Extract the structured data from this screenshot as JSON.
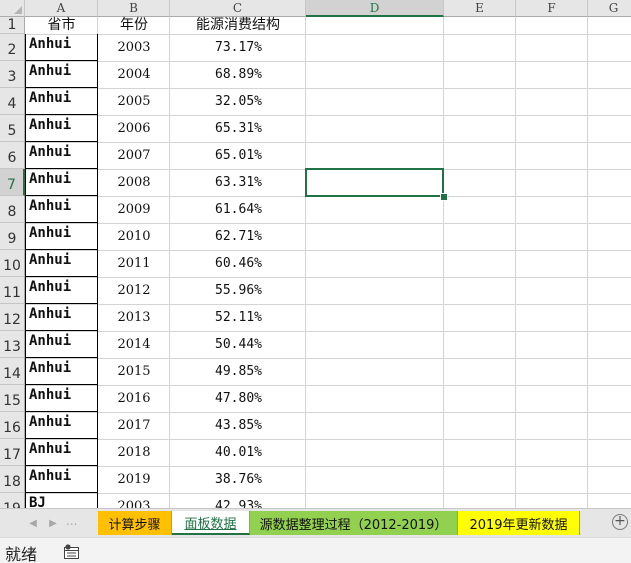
{
  "columns": [
    "A",
    "B",
    "C",
    "D",
    "E",
    "F",
    "G"
  ],
  "active_column": "D",
  "row_numbers": [
    "1",
    "2",
    "3",
    "4",
    "5",
    "6",
    "7",
    "8",
    "9",
    "10",
    "11",
    "12",
    "13",
    "14",
    "15",
    "16",
    "17",
    "18",
    "19"
  ],
  "active_row": "7",
  "header_row": {
    "a": "省市",
    "b": "年份",
    "c": "能源消费结构"
  },
  "rows": [
    {
      "province": "Anhui",
      "year": "2003",
      "value": "73.17%"
    },
    {
      "province": "Anhui",
      "year": "2004",
      "value": "68.89%"
    },
    {
      "province": "Anhui",
      "year": "2005",
      "value": "32.05%"
    },
    {
      "province": "Anhui",
      "year": "2006",
      "value": "65.31%"
    },
    {
      "province": "Anhui",
      "year": "2007",
      "value": "65.01%"
    },
    {
      "province": "Anhui",
      "year": "2008",
      "value": "63.31%"
    },
    {
      "province": "Anhui",
      "year": "2009",
      "value": "61.64%"
    },
    {
      "province": "Anhui",
      "year": "2010",
      "value": "62.71%"
    },
    {
      "province": "Anhui",
      "year": "2011",
      "value": "60.46%"
    },
    {
      "province": "Anhui",
      "year": "2012",
      "value": "55.96%"
    },
    {
      "province": "Anhui",
      "year": "2013",
      "value": "52.11%"
    },
    {
      "province": "Anhui",
      "year": "2014",
      "value": "50.44%"
    },
    {
      "province": "Anhui",
      "year": "2015",
      "value": "49.85%"
    },
    {
      "province": "Anhui",
      "year": "2016",
      "value": "47.80%"
    },
    {
      "province": "Anhui",
      "year": "2017",
      "value": "43.85%"
    },
    {
      "province": "Anhui",
      "year": "2018",
      "value": "40.01%"
    },
    {
      "province": "Anhui",
      "year": "2019",
      "value": "38.76%"
    },
    {
      "province": "BJ",
      "year": "2003",
      "value": "42.93%"
    }
  ],
  "tabs": [
    {
      "label": "计算步骤",
      "color": "#ffc000"
    },
    {
      "label": "面板数据",
      "color": "#ffffff",
      "active": true
    },
    {
      "label": "源数据整理过程（2012-2019）",
      "color": "#92d050"
    },
    {
      "label": "2019年更新数据",
      "color": "#ffff00"
    }
  ],
  "tab_nav": {
    "prev": "◀",
    "next": "▶",
    "dots": "..."
  },
  "add_sheet_label": "+",
  "status": {
    "ready": "就绪"
  },
  "icons": {
    "macro": "macro-record-icon",
    "add": "add-sheet-icon"
  },
  "accent_color": "#217346"
}
